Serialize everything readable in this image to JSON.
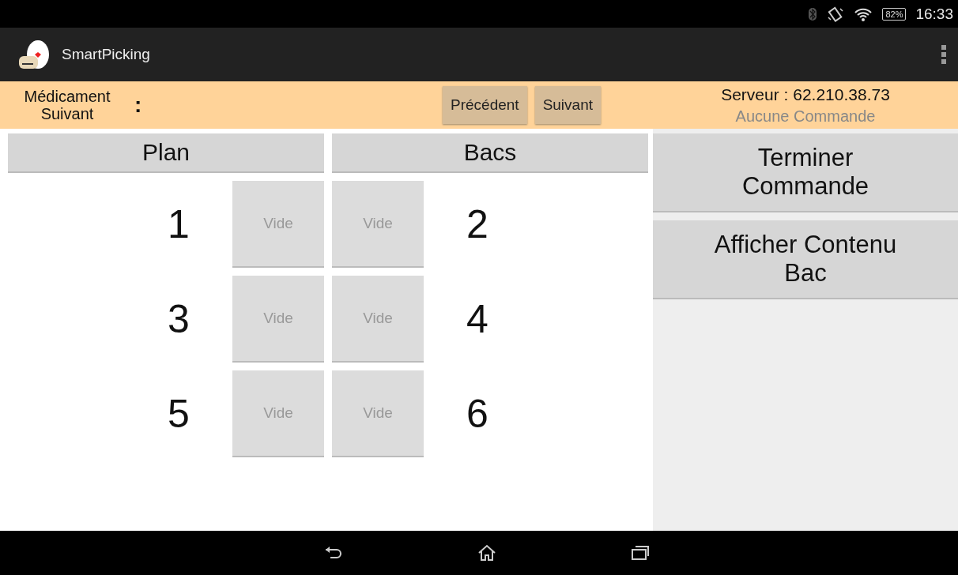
{
  "status_bar": {
    "battery": "82%",
    "time": "16:33"
  },
  "app_bar": {
    "title": "SmartPicking"
  },
  "info_bar": {
    "label": "Médicament Suivant",
    "separator": ":",
    "buttons": [
      "Précédent",
      "Suivant"
    ],
    "server": "Serveur : 62.210.38.73",
    "order": "Aucune Commande"
  },
  "headers": [
    "Plan",
    "Bacs"
  ],
  "bins": [
    {
      "left": {
        "number": "1",
        "status": "Vide"
      },
      "right": {
        "number": "2",
        "status": "Vide"
      }
    },
    {
      "left": {
        "number": "3",
        "status": "Vide"
      },
      "right": {
        "number": "4",
        "status": "Vide"
      }
    },
    {
      "left": {
        "number": "5",
        "status": "Vide"
      },
      "right": {
        "number": "6",
        "status": "Vide"
      }
    }
  ],
  "actions": [
    "Terminer Commande",
    "Afficher Contenu Bac"
  ]
}
